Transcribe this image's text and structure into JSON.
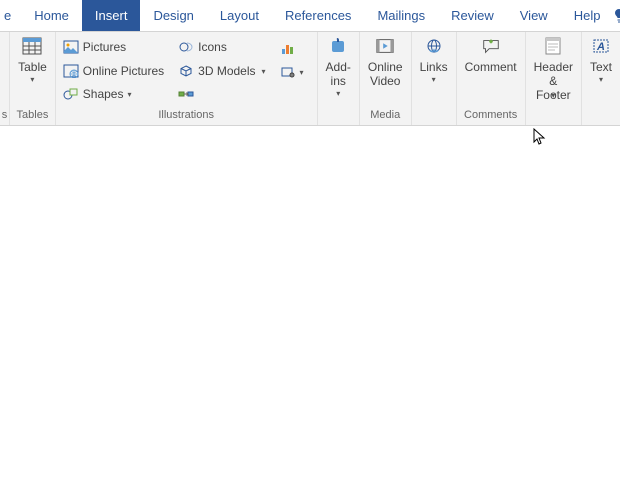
{
  "tabs": {
    "file": "e",
    "home": "Home",
    "insert": "Insert",
    "design": "Design",
    "layout": "Layout",
    "references": "References",
    "mailings": "Mailings",
    "review": "Review",
    "view": "View",
    "help": "Help"
  },
  "active_tab": "insert",
  "groups": {
    "pages": "s",
    "tables": "Tables",
    "illustrations": "Illustrations",
    "media": "Media",
    "comments": "Comments"
  },
  "buttons": {
    "table": "Table",
    "pictures": "Pictures",
    "online_pictures": "Online Pictures",
    "shapes": "Shapes",
    "icons": "Icons",
    "models3d": "3D Models",
    "addins": "Add-\nins",
    "online_video": "Online\nVideo",
    "links": "Links",
    "comment": "Comment",
    "header_footer": "Header &\nFooter",
    "text": "Text"
  },
  "colors": {
    "accent": "#2b579a",
    "ribbon_bg": "#f3f3f3"
  }
}
